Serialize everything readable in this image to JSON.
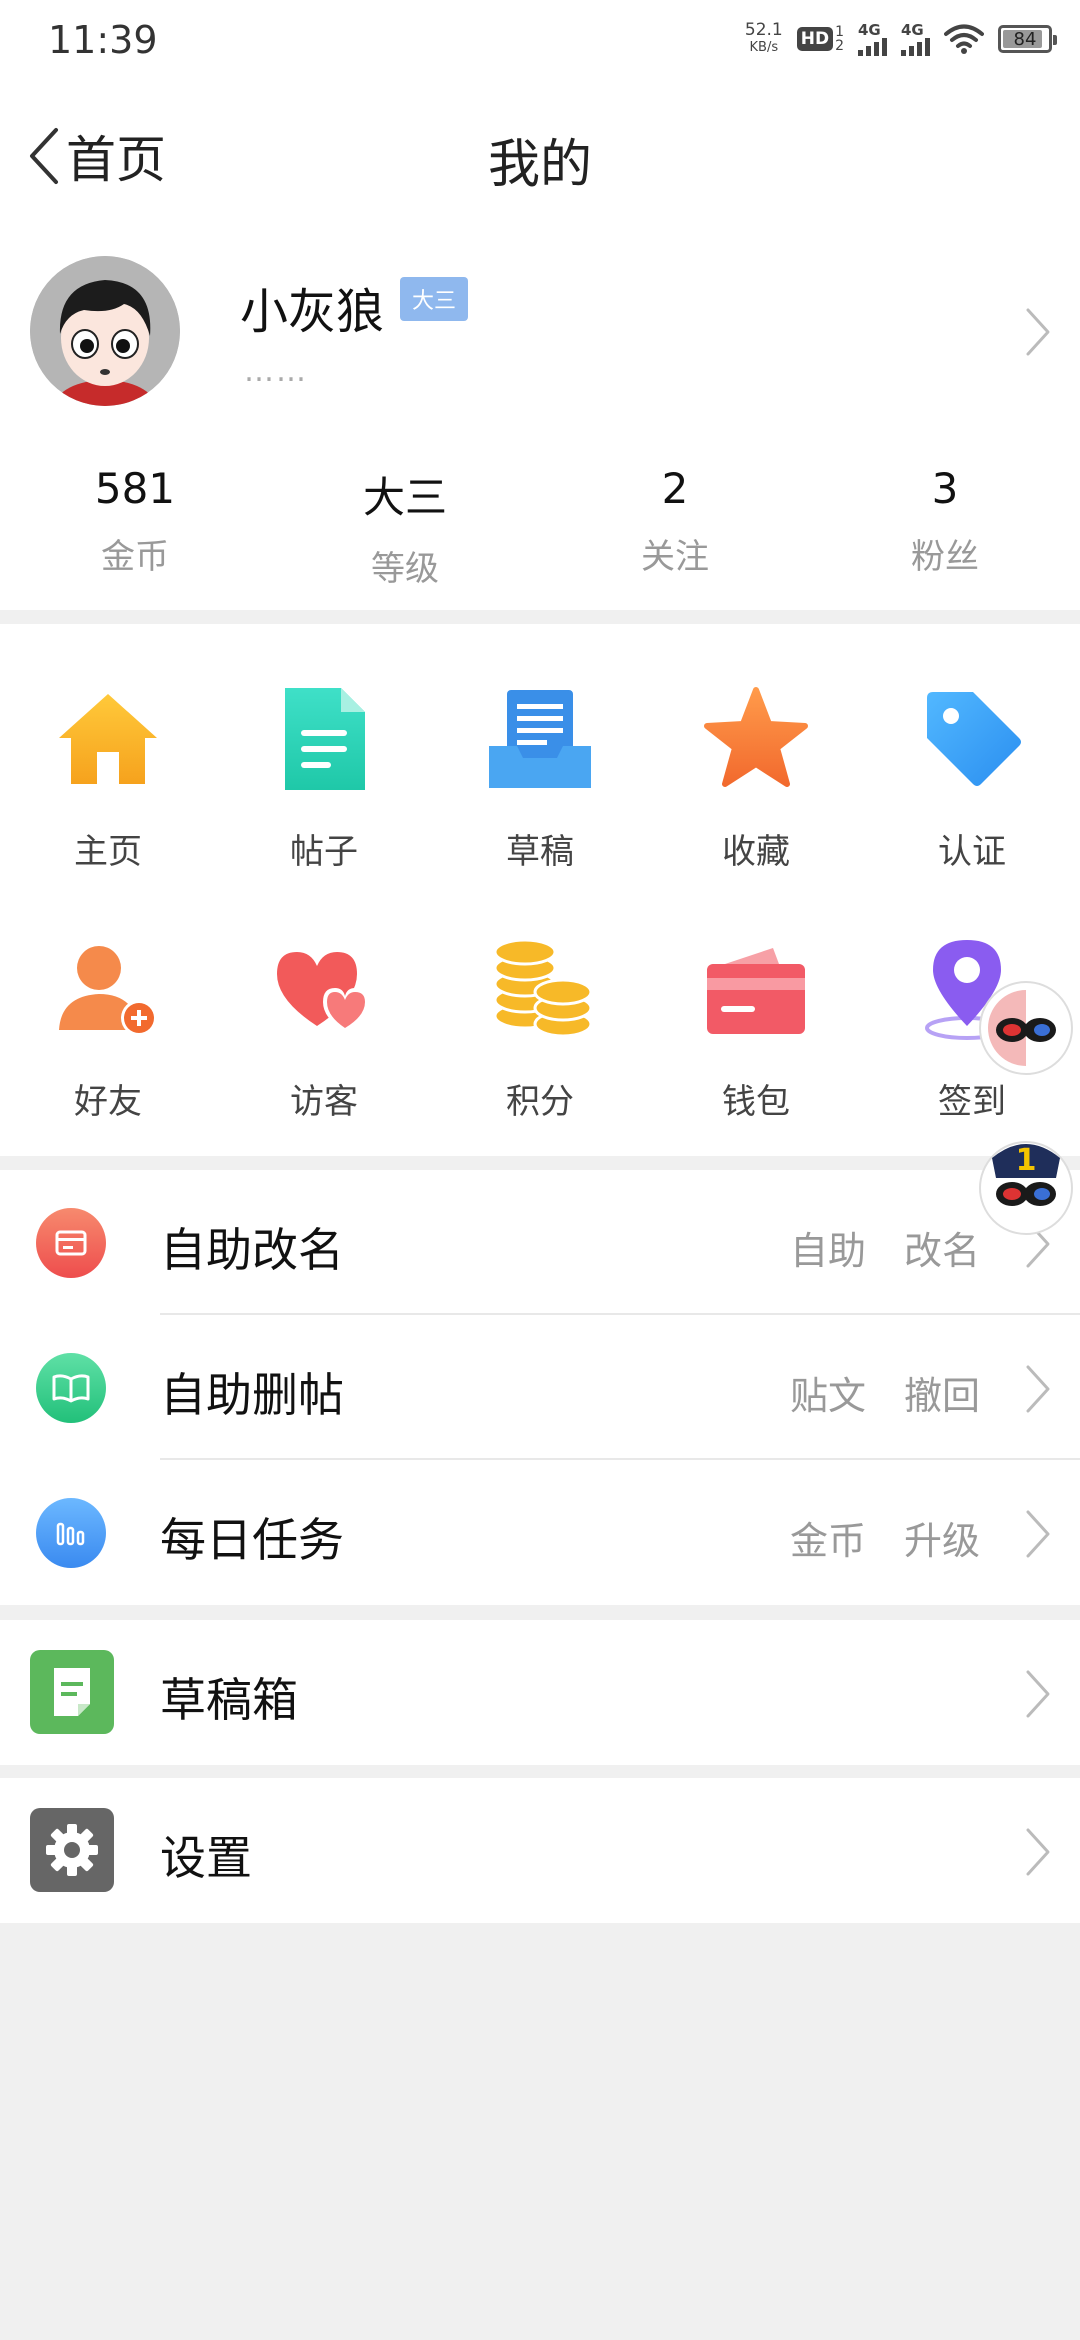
{
  "status_bar": {
    "time": "11:39",
    "net_speed": "52.1",
    "net_unit": "KB/s",
    "hd_label": "HD",
    "sim1": "1",
    "sim2": "2",
    "sig1_label": "4G",
    "sig2_label": "4G",
    "battery": "84",
    "battery_level": 0.84
  },
  "header": {
    "back_label": "首页",
    "title": "我的"
  },
  "profile": {
    "username": "小灰狼",
    "level_badge": "大三",
    "signature": "……"
  },
  "stats": [
    {
      "value": "581",
      "label": "金币"
    },
    {
      "value": "大三",
      "label": "等级"
    },
    {
      "value": "2",
      "label": "关注"
    },
    {
      "value": "3",
      "label": "粉丝"
    }
  ],
  "grid": [
    {
      "label": "主页",
      "icon": "home-icon"
    },
    {
      "label": "帖子",
      "icon": "document-icon"
    },
    {
      "label": "草稿",
      "icon": "draft-tray-icon"
    },
    {
      "label": "收藏",
      "icon": "star-icon"
    },
    {
      "label": "认证",
      "icon": "tag-icon"
    },
    {
      "label": "好友",
      "icon": "add-friend-icon"
    },
    {
      "label": "访客",
      "icon": "hearts-icon"
    },
    {
      "label": "积分",
      "icon": "coins-icon"
    },
    {
      "label": "钱包",
      "icon": "wallet-icon"
    },
    {
      "label": "签到",
      "icon": "location-pin-icon"
    }
  ],
  "list_group_1": [
    {
      "title": "自助改名",
      "tags": [
        "自助",
        "改名"
      ],
      "icon": "card-icon",
      "color": "#f26b5b"
    },
    {
      "title": "自助删帖",
      "tags": [
        "贴文",
        "撤回"
      ],
      "icon": "book-icon",
      "color": "#3ecf8e"
    },
    {
      "title": "每日任务",
      "tags": [
        "金币",
        "升级"
      ],
      "icon": "bar-chart-icon",
      "color": "#4a9ef5"
    }
  ],
  "drafts_row": {
    "title": "草稿箱",
    "icon": "note-icon",
    "color": "#5cb85c"
  },
  "settings_row": {
    "title": "设置",
    "icon": "gear-icon",
    "color": "#666666"
  },
  "floating_badge_count": "1"
}
